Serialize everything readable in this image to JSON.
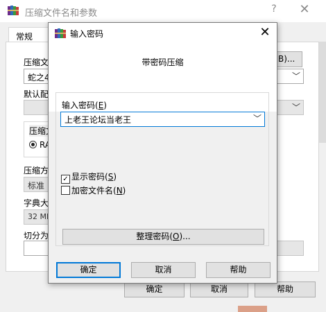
{
  "background_window": {
    "title": "压缩文件名和参数",
    "help_glyph": "?",
    "close_glyph": "✕",
    "tab_general": "常规",
    "archive_name_label": "压缩文",
    "browse_button_suffix": "B)...",
    "archive_name_value": "蛇之4",
    "profile_label": "默认配",
    "format_group_label": "压缩文",
    "format_radio_label": "RA",
    "method_label": "压缩方",
    "method_value": "标准",
    "dict_label": "字典大",
    "dict_value": "32 MB",
    "split_label": "切分为",
    "ok_button": "确定",
    "cancel_button": "取消",
    "help_button": "帮助"
  },
  "dialog": {
    "title": "输入密码",
    "close_glyph": "✕",
    "heading": "带密码压缩",
    "password_label": "输入密码(",
    "password_label_key": "E",
    "password_value": "上老王论坛当老王",
    "show_password_label": "显示密码(",
    "show_password_key": "S",
    "show_password_checked": true,
    "encrypt_filenames_label": "加密文件名(",
    "encrypt_filenames_key": "N",
    "encrypt_filenames_checked": false,
    "organize_button": "整理密码(",
    "organize_button_key": "O",
    "organize_button_suffix": ")...",
    "ok_button": "确定",
    "cancel_button": "取消",
    "help_button": "帮助"
  },
  "icons": {
    "app": "winrar-books-icon",
    "dropdown": "chevron-down-icon"
  }
}
